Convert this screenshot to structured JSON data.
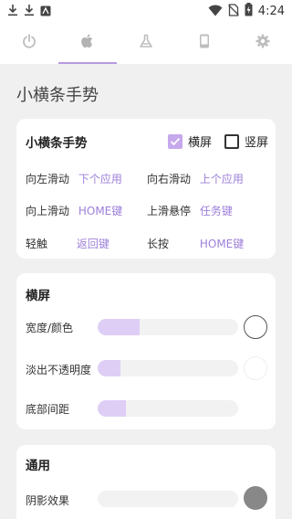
{
  "status_bar": {
    "time": "4:24",
    "left_icons": [
      "download-icon",
      "download-icon",
      "app-notification-icon"
    ],
    "right_icons": [
      "wifi-icon",
      "no-sim-icon",
      "battery-charging-icon"
    ]
  },
  "tabs": [
    {
      "icon": "power-icon",
      "active": false
    },
    {
      "icon": "apple-icon",
      "active": true
    },
    {
      "icon": "flask-icon",
      "active": false
    },
    {
      "icon": "phone-icon",
      "active": false
    },
    {
      "icon": "gear-icon",
      "active": false
    }
  ],
  "page": {
    "title": "小横条手势"
  },
  "gesture_card": {
    "title": "小横条手势",
    "landscape": {
      "label": "横屏",
      "checked": true
    },
    "portrait": {
      "label": "竖屏",
      "checked": false
    },
    "items": [
      {
        "label": "向左滑动",
        "value": "下个应用"
      },
      {
        "label": "向右滑动",
        "value": "上个应用"
      },
      {
        "label": "向上滑动",
        "value": "HOME键"
      },
      {
        "label": "上滑悬停",
        "value": "任务键"
      },
      {
        "label": "轻触",
        "value": "返回键"
      },
      {
        "label": "长按",
        "value": "HOME键"
      }
    ]
  },
  "landscape_card": {
    "title": "横屏",
    "rows": [
      {
        "label": "宽度/颜色",
        "level": 0.3,
        "swatch": "#ffffff"
      },
      {
        "label": "淡出不透明度",
        "level": 0.16
      },
      {
        "label": "底部间距",
        "level": 0.2
      }
    ]
  },
  "general_card": {
    "title": "通用",
    "rows": [
      {
        "label": "阴影效果",
        "level": 0.0,
        "swatch": "#888888"
      }
    ]
  },
  "colors": {
    "accent": "#b89ae0",
    "value_text": "#9d7fd9",
    "slider_fill": "#decef6",
    "slider_track": "#f2f2f2"
  }
}
